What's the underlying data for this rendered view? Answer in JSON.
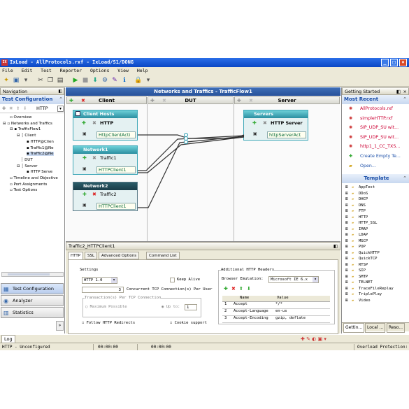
{
  "window": {
    "title": "IxLoad - AllProtocols.rxf - IxLoad/S1/DONG"
  },
  "menu": [
    "File",
    "Edit",
    "Test",
    "Reporter",
    "Options",
    "View",
    "Help"
  ],
  "navigation": {
    "header": "Navigation",
    "section": "Test Configuration",
    "breadcrumb": "HTTP",
    "tree": [
      "Overview",
      "Networks and Traffics",
      "TrafficFlow1",
      "Client",
      "HTTP@Clien",
      "Traffic1@Ne",
      "Traffic2@Ne",
      "DUT",
      "Server",
      "HTTP Serve",
      "Timeline and Objective",
      "Port Assignments",
      "Test Options"
    ],
    "buttons": [
      "Test Configuration",
      "Analyzer",
      "Statistics"
    ]
  },
  "diagram": {
    "title": "Networks and Traffics - TrafficFlow1",
    "columns": {
      "client": "Client",
      "dut": "DUT",
      "server": "Server"
    },
    "client_hosts": {
      "title": "Client Hosts",
      "activity": "HTTP",
      "agent": "HttpClientActi"
    },
    "network1": {
      "title": "Network1",
      "traffic": "Traffic1",
      "agent": "HTTPClient1"
    },
    "network2": {
      "title": "Network2",
      "traffic": "Traffic2",
      "agent": "HTTPClient1"
    },
    "servers": {
      "title": "Servers",
      "activity": "HTTP Server",
      "agent": "httpServerAct"
    }
  },
  "props": {
    "title": "Traffic2_HTTPClient1",
    "tabs": [
      "HTTP",
      "SSL",
      "Advanced Options",
      "Command List"
    ],
    "settings_label": "Settings",
    "http_version": "HTTP 1.0",
    "keep_alive": "Keep Alive",
    "concurrent_value": "3",
    "concurrent_label": "Concurrent TCP Connection(s) Per User",
    "transactions_label": "Transaction(s) Per TCP Connection",
    "max_possible": "Maximum Possible",
    "up_to": "Up to:",
    "up_to_value": "1",
    "follow_redirects": "Follow HTTP Redirects",
    "cookie_support": "Cookie support",
    "headers_label": "Additional HTTP Headers",
    "browser_emulation_label": "Browser Emulation:",
    "browser_emulation_value": "Microsoft IE 6.x",
    "headers_cols": [
      "Name",
      "Value"
    ],
    "headers_rows": [
      {
        "n": "1",
        "name": "Accept",
        "value": "*/*"
      },
      {
        "n": "2",
        "name": "Accept-Language",
        "value": "en-us"
      },
      {
        "n": "3",
        "name": "Accept-Encoding",
        "value": "gzip, deflate"
      }
    ]
  },
  "right": {
    "header": "Getting Started",
    "recent_title": "Most Recent",
    "recent": [
      "AllProtocols.rxf",
      "simpleHTTP.rxf",
      "SIP_UDP_SU wit...",
      "SIP_UDP_SU wit...",
      "http1_1_CC_TXS...",
      "Create Empty Te...",
      "Open..."
    ],
    "template_title": "Template",
    "templates": [
      "AppTest",
      "DDoS",
      "DHCP",
      "DNS",
      "FTP",
      "HTTP",
      "HTTP_SSL",
      "IMAP",
      "LDAP",
      "MGCP",
      "POP",
      "QuickHTTP",
      "QuickTCP",
      "RTSP",
      "SIP",
      "SMTP",
      "TELNET",
      "TraceFileReplay",
      "TriplePlay",
      "Video"
    ],
    "bottom_tabs": [
      "Gettin...",
      "Local ...",
      "Reso..."
    ]
  },
  "log": {
    "tab": "Log"
  },
  "status": {
    "left": "HTTP - Unconfigured",
    "time1": "00:00:00",
    "time2": "00:00:00",
    "right": "Overload Protection:"
  }
}
